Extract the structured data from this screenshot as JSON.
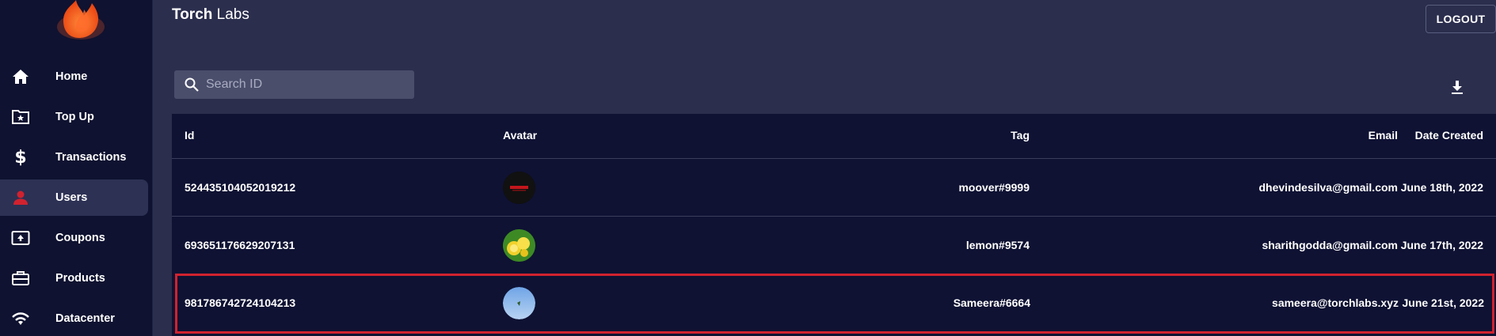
{
  "app": {
    "brand_bold": "Torch",
    "brand_rest": " Labs",
    "logout_label": "LOGOUT"
  },
  "sidebar": {
    "items": [
      {
        "label": "Home",
        "icon": "home-icon"
      },
      {
        "label": "Top Up",
        "icon": "folder-star-icon"
      },
      {
        "label": "Transactions",
        "icon": "dollar-icon"
      },
      {
        "label": "Users",
        "icon": "person-icon",
        "active": true
      },
      {
        "label": "Coupons",
        "icon": "upload-box-icon"
      },
      {
        "label": "Products",
        "icon": "briefcase-icon"
      },
      {
        "label": "Datacenter",
        "icon": "wifi-icon"
      }
    ]
  },
  "search": {
    "placeholder": "Search ID"
  },
  "table": {
    "columns": [
      "Id",
      "Avatar",
      "Tag",
      "Email",
      "Date Created"
    ],
    "rows": [
      {
        "id": "524435104052019212",
        "avatar": "moover-avatar",
        "tag": "moover#9999",
        "email": "dhevindesilva@gmail.com",
        "date": "June 18th, 2022"
      },
      {
        "id": "693651176629207131",
        "avatar": "lemon-avatar",
        "tag": "lemon#9574",
        "email": "sharithgodda@gmail.com",
        "date": "June 17th, 2022"
      },
      {
        "id": "981786742724104213",
        "avatar": "sky-avatar",
        "tag": "Sameera#6664",
        "email": "sameera@torchlabs.xyz",
        "date": "June 21st, 2022",
        "highlighted": true
      }
    ]
  },
  "colors": {
    "background": "#2b2e4d",
    "sidebar": "#0f1230",
    "table": "#0f1233",
    "active_nav": "#2d3154",
    "accent_red": "#d1222f",
    "logo_orange": "#ff5a1f"
  }
}
